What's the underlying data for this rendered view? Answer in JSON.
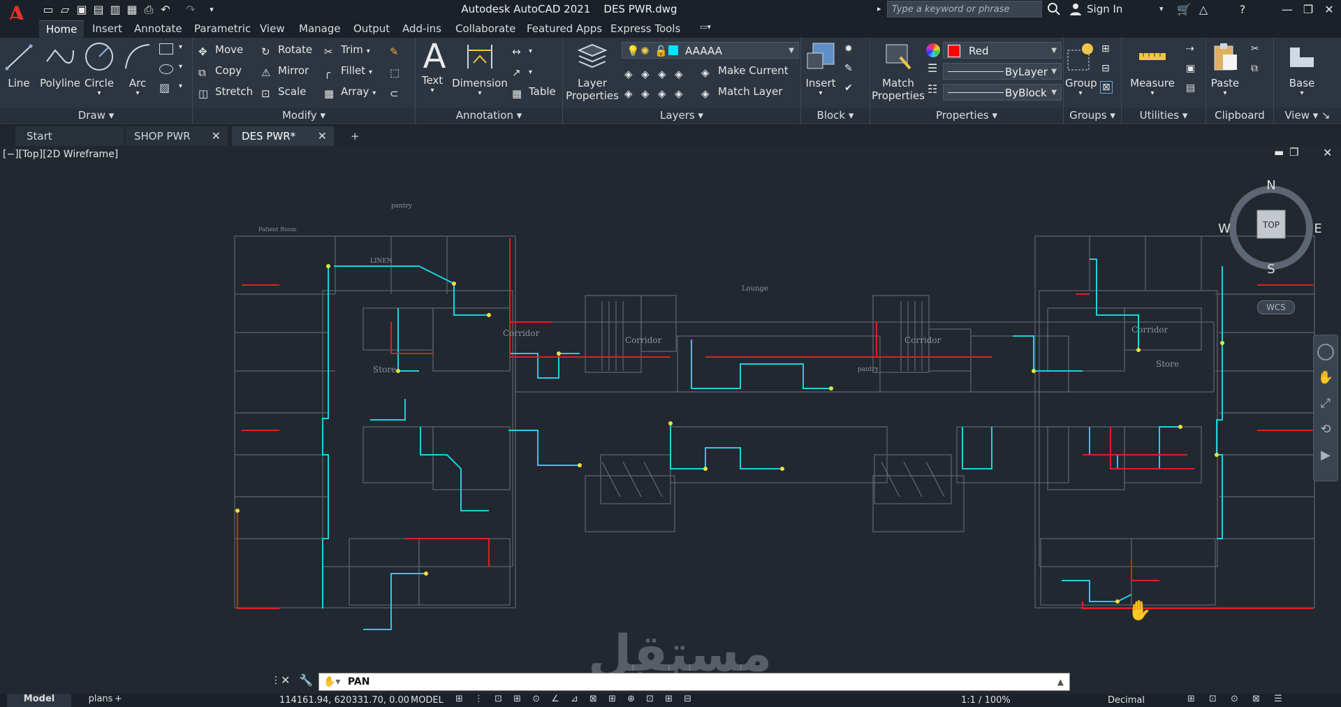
{
  "app": {
    "logo": "A",
    "title": "Autodesk AutoCAD 2021    DES PWR.dwg",
    "search_placeholder": "Type a keyword or phrase",
    "sign_in": "Sign In"
  },
  "ribbon_tabs": [
    "Home",
    "Insert",
    "Annotate",
    "Parametric",
    "View",
    "Manage",
    "Output",
    "Add-ins",
    "Collaborate",
    "Featured Apps",
    "Express Tools"
  ],
  "active_tab": "Home",
  "draw": {
    "title": "Draw",
    "line": "Line",
    "polyline": "Polyline",
    "circle": "Circle",
    "arc": "Arc"
  },
  "modify": {
    "title": "Modify",
    "move": "Move",
    "rotate": "Rotate",
    "trim": "Trim",
    "copy": "Copy",
    "mirror": "Mirror",
    "fillet": "Fillet",
    "stretch": "Stretch",
    "scale": "Scale",
    "array": "Array"
  },
  "annotation": {
    "title": "Annotation",
    "text": "Text",
    "dimension": "Dimension",
    "table": "Table"
  },
  "layers": {
    "title": "Layers",
    "layer_properties": "Layer Properties",
    "current_layer": "AAAAA",
    "make_current": "Make Current",
    "match_layer": "Match Layer"
  },
  "block": {
    "title": "Block",
    "insert": "Insert"
  },
  "properties": {
    "title": "Properties",
    "match_properties": "Match Properties",
    "color": "Red",
    "linetype": "ByLayer",
    "lineweight": "ByBlock"
  },
  "groups": {
    "title": "Groups",
    "group": "Group"
  },
  "utilities": {
    "title": "Utilities",
    "measure": "Measure"
  },
  "clipboard": {
    "title": "Clipboard",
    "paste": "Paste"
  },
  "view": {
    "title": "View",
    "base": "Base"
  },
  "file_tabs": {
    "start": "Start",
    "shop": "SHOP PWR",
    "des": "DES PWR*"
  },
  "viewport": {
    "label": "[−][Top][2D Wireframe]",
    "viewcube": {
      "n": "N",
      "s": "S",
      "e": "E",
      "w": "W",
      "top": "TOP",
      "wcs": "WCS"
    },
    "room_labels": [
      "Corridor",
      "Corridor",
      "Corridor",
      "Corridor",
      "Store",
      "Store",
      "Lounge",
      "pantry",
      "pantry",
      "LINEN",
      "Patient Room"
    ]
  },
  "command": {
    "text": "PAN"
  },
  "watermark": "mostaql.com",
  "status": {
    "model": "Model",
    "layout": "plans",
    "coords": "114161.94, 620331.70, 0.00",
    "mode": "MODEL",
    "scale": "1:1 / 100%",
    "units": "Decimal"
  }
}
